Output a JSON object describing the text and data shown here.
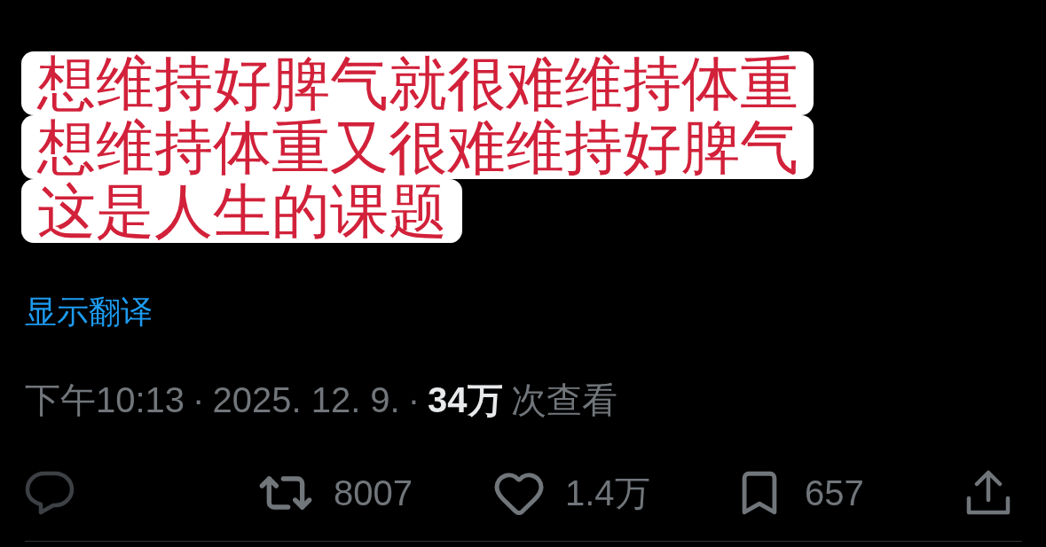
{
  "caption_lines": [
    "想维持好脾气就很难维持体重",
    "想维持体重又很难维持好脾气",
    "这是人生的课题"
  ],
  "translate_link": "显示翻译",
  "meta": {
    "time": "下午10:13",
    "separators": [
      "·",
      "·"
    ],
    "date": "2025. 12. 9.",
    "views_count": "34万",
    "views_label": "次查看"
  },
  "actions": [
    {
      "kind": "reply"
    },
    {
      "kind": "retweet",
      "count": "8007"
    },
    {
      "kind": "like",
      "count": "1.4万"
    },
    {
      "kind": "bookmark",
      "count": "657"
    },
    {
      "kind": "share"
    }
  ]
}
